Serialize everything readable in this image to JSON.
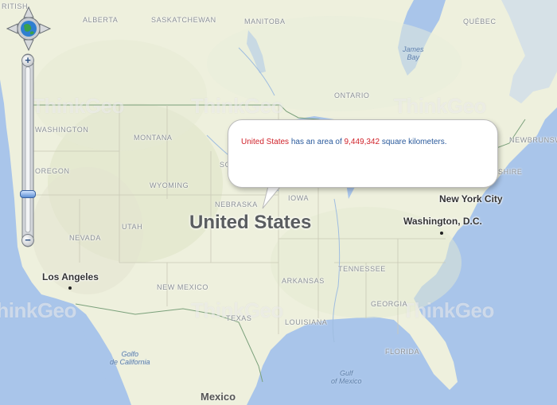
{
  "map": {
    "states": [
      "ALBERTA",
      "SASKATCHEWAN",
      "MANITOBA",
      "QUÉBEC",
      "ONTARIO",
      "WASHINGTON",
      "MONTANA",
      "OREGON",
      "WYOMING",
      "NEBRASKA",
      "IOWA",
      "NEVADA",
      "UTAH",
      "NEW MEXICO",
      "ARKANSAS",
      "TENNESSEE",
      "GEORGIA",
      "TEXAS",
      "LOUISIANA",
      "FLORIDA",
      "NEWBRUNSWICK",
      "SHIRE",
      "RITISH"
    ],
    "sd_partial": "SC",
    "water": {
      "james_bay": "James\nBay",
      "gulf_california": "Golfo\nde California",
      "gulf_mexico": "Gulf\nof Mexico"
    },
    "cities": {
      "los_angeles": "Los Angeles",
      "new_york": "New York City",
      "washington_dc": "Washington, D.C."
    },
    "country_label": "United States",
    "mexico_label": "Mexico",
    "watermarks": [
      "ThinkGeo",
      "ThinkGeo",
      "ThinkGeo",
      "ThinkGeo",
      "ThinkGeo",
      "ThinkGeo"
    ]
  },
  "popup": {
    "country": "United States",
    "pre_area": " has an area of ",
    "area": "9,449,342",
    "post_area": " square kilometers."
  },
  "controls": {
    "zoom_in": "+",
    "zoom_out": "−",
    "zoom_level_fraction": 0.2
  },
  "colors": {
    "land": "#eef0dd",
    "water": "#a9c5ea",
    "highlight": "#d0222a",
    "popup_text": "#2a5a9c"
  }
}
